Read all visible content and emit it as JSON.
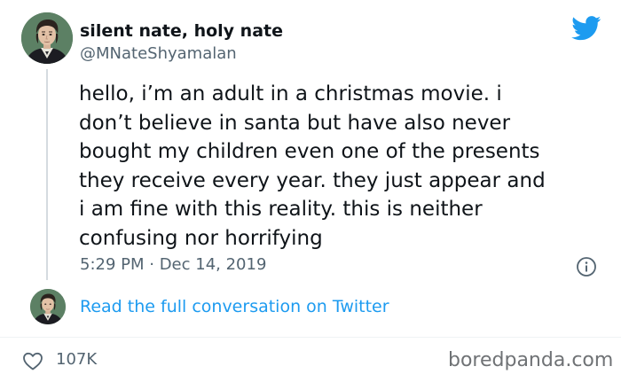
{
  "tweet": {
    "display_name": "silent nate, holy nate",
    "handle": "@MNateShyamalan",
    "text_lines": [
      "hello, i’m an adult in a christmas movie. i",
      "don’t believe in santa but have also never",
      "bought my children even one of the presents",
      "they receive every year. they just appear and",
      "i am fine with this reality. this is neither",
      "confusing nor horrifying"
    ],
    "timestamp": "5:29 PM · Dec 14, 2019",
    "read_more": "Read the full conversation on Twitter",
    "likes": "107K"
  },
  "watermark": "boredpanda.com",
  "icons": {
    "brand": "twitter-bird-icon",
    "info": "info-icon",
    "like": "heart-icon"
  },
  "colors": {
    "twitter_blue": "#1d9bf0",
    "text": "#0f1419",
    "secondary_text": "#536471",
    "divider": "#eff3f4",
    "thread_line": "#d5dbe0"
  }
}
